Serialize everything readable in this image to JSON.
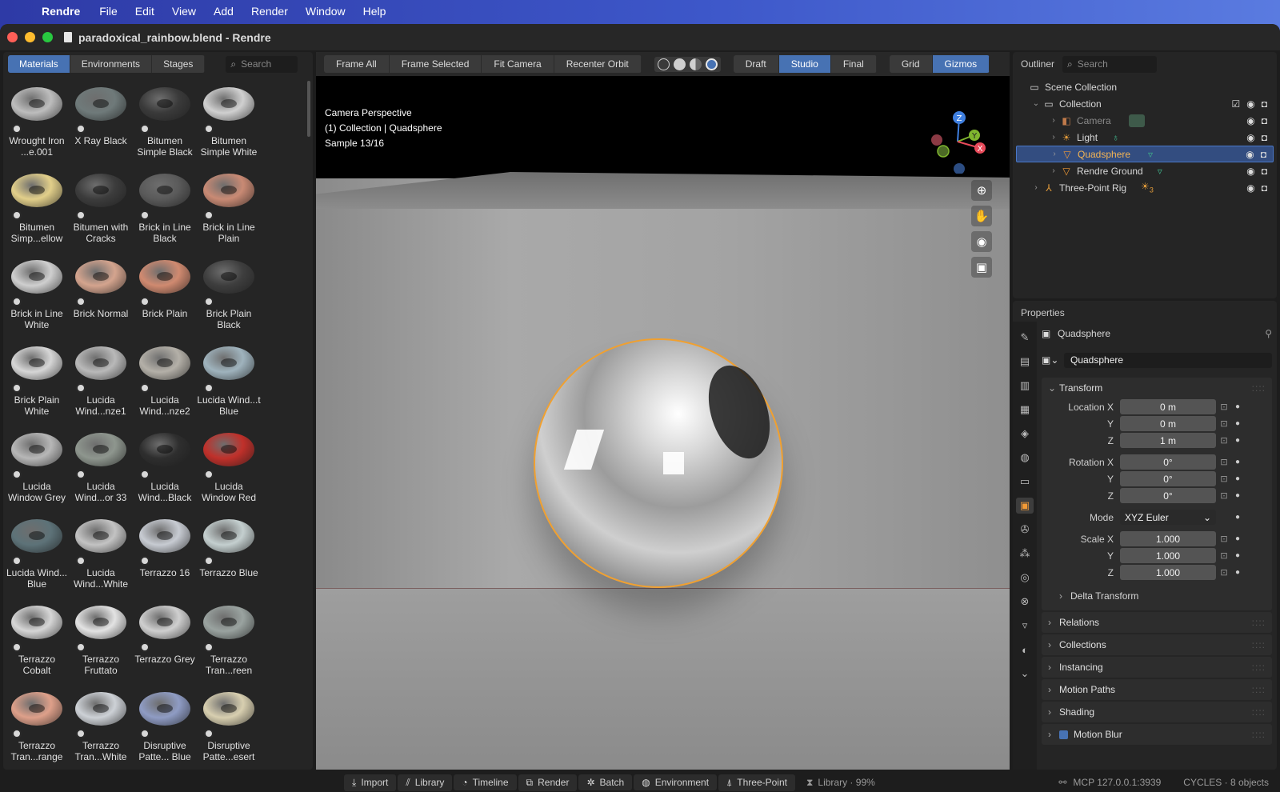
{
  "menubar": {
    "app": "Rendre",
    "items": [
      "File",
      "Edit",
      "View",
      "Add",
      "Render",
      "Window",
      "Help"
    ]
  },
  "window": {
    "title": "paradoxical_rainbow.blend - Rendre"
  },
  "library": {
    "tabs": [
      "Materials",
      "Environments",
      "Stages"
    ],
    "active_tab": "Materials",
    "search_placeholder": "Search",
    "materials": [
      {
        "label": "Wrought Iron ...e.001",
        "color": "#bdbdbd"
      },
      {
        "label": "X Ray Black",
        "color": "#6f7a7a"
      },
      {
        "label": "Bitumen Simple Black",
        "color": "#3a3a3a"
      },
      {
        "label": "Bitumen Simple White",
        "color": "#d0d0d0"
      },
      {
        "label": "Bitumen Simp...ellow",
        "color": "#e2cf8a"
      },
      {
        "label": "Bitumen with Cracks",
        "color": "#3c3c3c"
      },
      {
        "label": "Brick in Line Black",
        "color": "#5a5a5a"
      },
      {
        "label": "Brick in Line Plain",
        "color": "#c98a74"
      },
      {
        "label": "Brick in Line White",
        "color": "#cfcfcf"
      },
      {
        "label": "Brick Normal",
        "color": "#d4a48e"
      },
      {
        "label": "Brick Plain",
        "color": "#d08a70"
      },
      {
        "label": "Brick Plain Black",
        "color": "#3e3e3e"
      },
      {
        "label": "Brick Plain White",
        "color": "#d6d6d6"
      },
      {
        "label": "Lucida Wind...nze1",
        "color": "#b9b9b9"
      },
      {
        "label": "Lucida Wind...nze2",
        "color": "#b4b0a8"
      },
      {
        "label": "Lucida Wind...t Blue",
        "color": "#9fb3bd"
      },
      {
        "label": "Lucida Window Grey",
        "color": "#b7b7b7"
      },
      {
        "label": "Lucida Wind...or 33",
        "color": "#8e968e"
      },
      {
        "label": "Lucida Wind...Black",
        "color": "#2e2e2e"
      },
      {
        "label": "Lucida Window Red",
        "color": "#c0302a"
      },
      {
        "label": "Lucida Wind... Blue",
        "color": "#5d7278"
      },
      {
        "label": "Lucida Wind...White",
        "color": "#c3c3c3"
      },
      {
        "label": "Terrazzo 16",
        "color": "#c7cbd2"
      },
      {
        "label": "Terrazzo Blue",
        "color": "#c4cfcf"
      },
      {
        "label": "Terrazzo Cobalt",
        "color": "#d6d6d6"
      },
      {
        "label": "Terrazzo Fruttato",
        "color": "#e3e3e3"
      },
      {
        "label": "Terrazzo Grey",
        "color": "#cfcfcf"
      },
      {
        "label": "Terrazzo Tran...reen",
        "color": "#9aa3a0"
      },
      {
        "label": "Terrazzo Tran...range",
        "color": "#dea08a"
      },
      {
        "label": "Terrazzo Tran...White",
        "color": "#cdd1d6"
      },
      {
        "label": "Disruptive Patte... Blue",
        "color": "#8f9cc4"
      },
      {
        "label": "Disruptive Patte...esert",
        "color": "#d8cfb0"
      }
    ]
  },
  "viewport": {
    "toolbar": {
      "frame_all": "Frame All",
      "frame_selected": "Frame Selected",
      "fit_camera": "Fit Camera",
      "recenter_orbit": "Recenter Orbit",
      "quality": [
        "Draft",
        "Studio",
        "Final"
      ],
      "quality_active": "Studio",
      "grid": "Grid",
      "gizmos": "Gizmos"
    },
    "overlay": {
      "line1": "Camera Perspective",
      "line2": "(1) Collection | Quadsphere",
      "line3": "Sample 13/16"
    },
    "gizmo": {
      "z": "Z",
      "y": "Y",
      "x": "X"
    }
  },
  "outliner": {
    "title": "Outliner",
    "search_placeholder": "Search",
    "rows": [
      {
        "label": "Scene Collection"
      },
      {
        "label": "Collection"
      },
      {
        "label": "Camera"
      },
      {
        "label": "Light"
      },
      {
        "label": "Quadsphere"
      },
      {
        "label": "Rendre Ground"
      },
      {
        "label": "Three-Point Rig",
        "badge": "3"
      }
    ]
  },
  "properties": {
    "title": "Properties",
    "object_name": "Quadsphere",
    "data_name": "Quadsphere",
    "transform": {
      "header": "Transform",
      "location_label": "Location X",
      "location": [
        "0 m",
        "0 m",
        "1 m"
      ],
      "rotation_label": "Rotation X",
      "rotation": [
        "0°",
        "0°",
        "0°"
      ],
      "mode_label": "Mode",
      "mode": "XYZ Euler",
      "scale_label": "Scale X",
      "scale": [
        "1.000",
        "1.000",
        "1.000"
      ],
      "y_label": "Y",
      "z_label": "Z",
      "delta": "Delta Transform"
    },
    "sections": [
      "Relations",
      "Collections",
      "Instancing",
      "Motion Paths",
      "Shading",
      "Motion Blur"
    ]
  },
  "statusbar": {
    "items": [
      "Import",
      "Library",
      "Timeline",
      "Render",
      "Batch",
      "Environment",
      "Three-Point"
    ],
    "library_progress": "Library · 99%",
    "mcp": "MCP 127.0.0.1:3939",
    "engine": "CYCLES · 8 objects"
  }
}
